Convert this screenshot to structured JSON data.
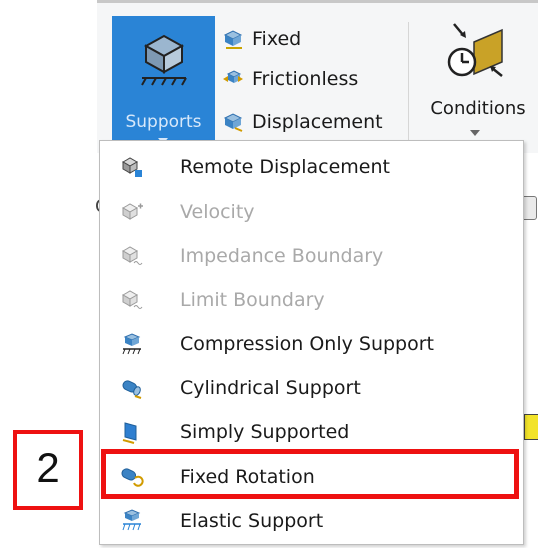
{
  "ribbon": {
    "supports_label": "Supports",
    "items": [
      {
        "label": "Fixed",
        "icon": "fixed-support-icon"
      },
      {
        "label": "Frictionless",
        "icon": "frictionless-icon"
      },
      {
        "label": "Displacement",
        "icon": "displacement-icon"
      }
    ],
    "conditions_label": "Conditions"
  },
  "menu": {
    "items": [
      {
        "label": "Remote Displacement",
        "enabled": true,
        "icon": "remote-displacement-icon"
      },
      {
        "label": "Velocity",
        "enabled": false,
        "icon": "velocity-icon"
      },
      {
        "label": "Impedance Boundary",
        "enabled": false,
        "icon": "impedance-boundary-icon"
      },
      {
        "label": "Limit Boundary",
        "enabled": false,
        "icon": "limit-boundary-icon"
      },
      {
        "label": "Compression Only Support",
        "enabled": true,
        "icon": "compression-support-icon"
      },
      {
        "label": "Cylindrical Support",
        "enabled": true,
        "icon": "cylindrical-support-icon"
      },
      {
        "label": "Simply Supported",
        "enabled": true,
        "icon": "simply-supported-icon"
      },
      {
        "label": "Fixed Rotation",
        "enabled": true,
        "icon": "fixed-rotation-icon"
      },
      {
        "label": "Elastic Support",
        "enabled": true,
        "icon": "elastic-support-icon"
      }
    ]
  },
  "callout": {
    "step": "2"
  },
  "colors": {
    "accent": "#2a84d6",
    "highlight": "#ee1111"
  }
}
